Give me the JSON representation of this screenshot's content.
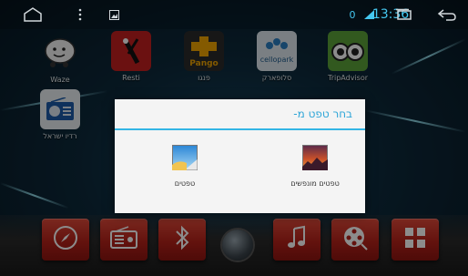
{
  "statusbar": {
    "home_icon": "home-outline-icon",
    "menu_icon": "kebab-menu-icon",
    "image_icon": "image-notification-icon",
    "indicator": "0",
    "time": "13:36",
    "recents_icon": "recents-icon",
    "back_icon": "back-arrow-icon"
  },
  "apps": [
    {
      "label": "Waze",
      "icon": "waze-icon",
      "color": "#5ec4e6"
    },
    {
      "label": "Resti",
      "icon": "resti-icon",
      "color": "#c42020"
    },
    {
      "label": "פנגו",
      "icon": "pango-icon",
      "color": "#f0a400"
    },
    {
      "label": "סלופארק",
      "icon": "cellopark-icon",
      "color": "#1f7fc2"
    },
    {
      "label": "TripAdvisor",
      "icon": "tripadvisor-icon",
      "color": "#5ca33a"
    },
    {
      "label": "רדיו ישראל",
      "icon": "radio-icon",
      "color": "#1d5aa8"
    }
  ],
  "dialog": {
    "title": "בחר טפט מ-",
    "options": [
      {
        "label": "טפטים מונפשים",
        "icon": "live-wallpaper-icon"
      },
      {
        "label": "טפטים",
        "icon": "wallpaper-gallery-icon"
      }
    ]
  },
  "dock": [
    {
      "name": "navigation",
      "icon": "compass-icon"
    },
    {
      "name": "radio",
      "icon": "radio-icon"
    },
    {
      "name": "bluetooth",
      "icon": "bluetooth-icon"
    },
    {
      "name": "music",
      "icon": "music-note-icon"
    },
    {
      "name": "video",
      "icon": "film-reel-icon"
    },
    {
      "name": "apps",
      "icon": "apps-grid-icon"
    }
  ]
}
